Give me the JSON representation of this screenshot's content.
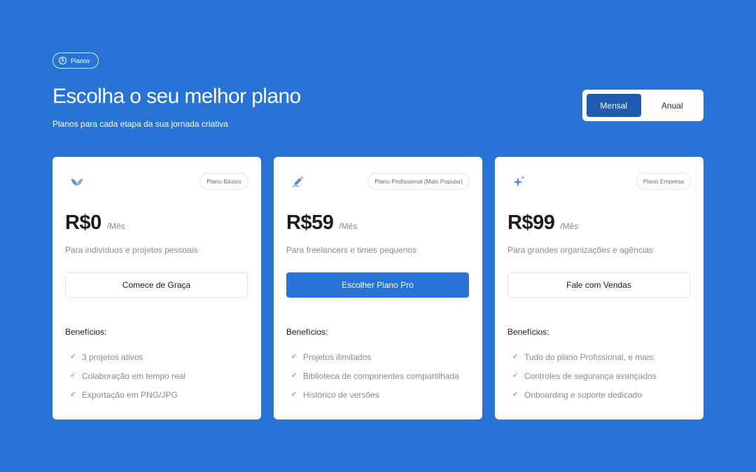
{
  "badge": {
    "icon": "dollar-coin-icon",
    "label": "Planos"
  },
  "header": {
    "title": "Escolha o seu melhor plano",
    "subtitle": "Planos para cada etapa da sua jornada criativa"
  },
  "billing_toggle": {
    "options": [
      "Mensal",
      "Anual"
    ],
    "selected": "Mensal"
  },
  "colors": {
    "background": "#2874D6",
    "toggle_active": "#1F5BAE",
    "primary_button": "#2874D6",
    "check": "#E0495C",
    "icon": "#5B8FD9"
  },
  "plans": [
    {
      "icon": "leaf-icon",
      "tag": "Plano Básico",
      "price": "R$0",
      "period": "/Mês",
      "description": "Para indivíduos e projetos pessoais",
      "cta": "Comece de Graça",
      "benefits_title": "Benefícios:",
      "benefits": [
        "3 projetos ativos",
        "Colaboração em tempo real",
        "Exportação em PNG/JPG"
      ]
    },
    {
      "icon": "pen-icon",
      "tag": "Plano Profissional (Mais Popular)",
      "price": "R$59",
      "period": "/Mês",
      "description": "Para freelancers e times pequenos",
      "cta": "Escolher Plano Pro",
      "benefits_title": "Benefícios:",
      "benefits": [
        "Projetos ilimitados",
        "Biblioteca de componentes compartilhada",
        "Histórico de versões"
      ]
    },
    {
      "icon": "sparkle-icon",
      "tag": "Plano Empresa",
      "price": "R$99",
      "period": "/Mês",
      "description": "Para grandes organizações e agências",
      "cta": "Fale com Vendas",
      "benefits_title": "Benefícios:",
      "benefits": [
        "Tudo do plano Profissional, e mais:",
        "Controles de segurança avançados",
        "Onboarding e suporte dedicado"
      ]
    }
  ]
}
